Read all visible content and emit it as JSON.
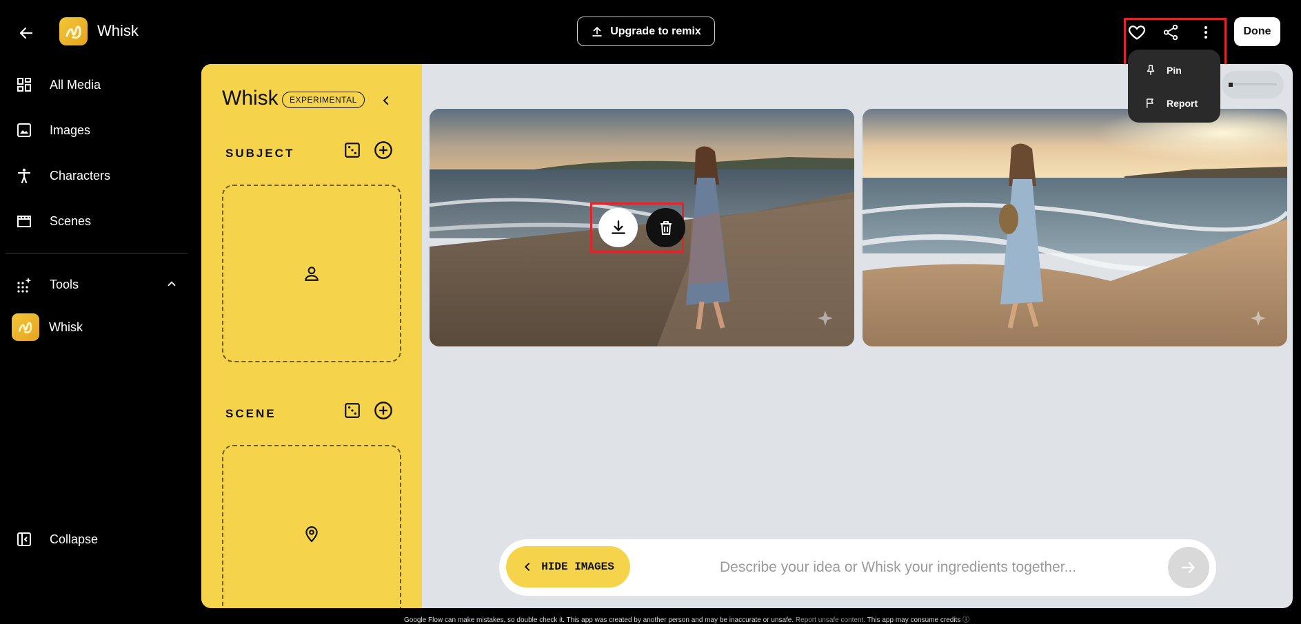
{
  "header": {
    "app_title": "Whisk",
    "upgrade_label": "Upgrade to remix",
    "done_label": "Done"
  },
  "sidebar": {
    "items": [
      {
        "label": "All Media",
        "icon": "grid-icon"
      },
      {
        "label": "Images",
        "icon": "image-icon"
      },
      {
        "label": "Characters",
        "icon": "person-icon"
      },
      {
        "label": "Scenes",
        "icon": "film-icon"
      }
    ],
    "tools_label": "Tools",
    "tool_app_label": "Whisk",
    "collapse_label": "Collapse"
  },
  "panel": {
    "title": "Whisk",
    "badge": "EXPERIMENTAL",
    "subject_label": "SUBJECT",
    "scene_label": "SCENE"
  },
  "prompt": {
    "hide_images_label": "HIDE IMAGES",
    "placeholder": "Describe your idea or Whisk your ingredients together..."
  },
  "menu": {
    "items": [
      {
        "label": "Pin",
        "icon": "pin-icon"
      },
      {
        "label": "Report",
        "icon": "flag-icon"
      }
    ]
  },
  "footer": {
    "text_main": "Google Flow can make mistakes, so double check it. This app was created by another person and may be inaccurate or unsafe.",
    "link_report": "Report unsafe content.",
    "text_end": "This app may consume credits"
  },
  "colors": {
    "accent_yellow": "#f5d34a",
    "canvas_bg": "#dfe3e7",
    "highlight_red": "#e0242b"
  }
}
